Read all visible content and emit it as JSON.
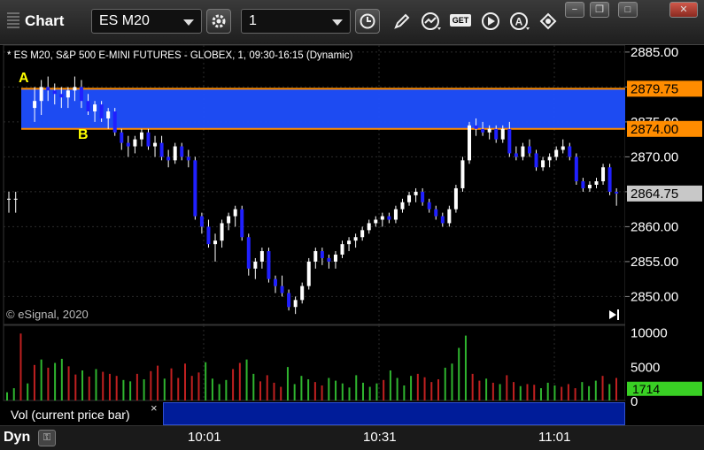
{
  "app": {
    "title": "Chart"
  },
  "toolbar": {
    "symbol": "ES M20",
    "interval": "1",
    "buttons": [
      "gear-icon",
      "clock-icon",
      "pencil-icon",
      "study-icon",
      "get-icon",
      "play-icon",
      "alert-icon",
      "link-icon"
    ],
    "get_label": "GET",
    "alert_label": "A"
  },
  "window_buttons": {
    "min": "−",
    "restore": "❐",
    "max": "□",
    "close": "✕"
  },
  "chart_data": {
    "type": "candlestick",
    "title": "* ES M20, S&P 500 E-MINI FUTURES - GLOBEX, 1, 09:30-16:15 (Dynamic)",
    "watermark": "© eSignal, 2020",
    "ylim": [
      2846,
      2886
    ],
    "yticks": [
      "2885.00",
      "2880.00",
      "2875.00",
      "2870.00",
      "2865.00",
      "2860.00",
      "2855.00",
      "2850.00"
    ],
    "band": {
      "top": 2879.75,
      "bottom": 2874.0,
      "color": "#1f4fff",
      "line_color": "#ff8c00"
    },
    "labels": {
      "band_top": "2879.75",
      "band_bottom": "2874.00",
      "last_price": "2864.75",
      "point_a": "A",
      "point_b": "B"
    },
    "last_price_value": 2864.75,
    "up_color": "#ffffff",
    "down_color": "#2020ff",
    "xticks": [
      "10:01",
      "10:31",
      "11:01"
    ],
    "candles_ohlc": [
      [
        2864,
        2865,
        2862,
        2864
      ],
      [
        2864,
        2865,
        2862,
        2864
      ],
      [
        2877,
        2880,
        2875,
        2878
      ],
      [
        2878,
        2881,
        2876,
        2880
      ],
      [
        2880,
        2881.5,
        2878,
        2879.5
      ],
      [
        2879.5,
        2880.5,
        2877.5,
        2879
      ],
      [
        2879,
        2880,
        2877,
        2878.5
      ],
      [
        2878.5,
        2880,
        2877,
        2879.5
      ],
      [
        2879.5,
        2881.5,
        2878,
        2880
      ],
      [
        2880,
        2881,
        2877,
        2878
      ],
      [
        2878,
        2879,
        2876,
        2876.5
      ],
      [
        2876.5,
        2878,
        2875,
        2877.5
      ],
      [
        2877.5,
        2878,
        2875,
        2875.5
      ],
      [
        2875.5,
        2877,
        2874,
        2876.5
      ],
      [
        2876.5,
        2877,
        2873,
        2873.5
      ],
      [
        2873.5,
        2874,
        2871,
        2872
      ],
      [
        2872,
        2873,
        2870,
        2871.5
      ],
      [
        2871.5,
        2873,
        2870.5,
        2872.5
      ],
      [
        2872.5,
        2874,
        2871.5,
        2873.5
      ],
      [
        2873.5,
        2874,
        2871,
        2871.5
      ],
      [
        2871.5,
        2873,
        2870,
        2872
      ],
      [
        2872,
        2873,
        2869.5,
        2870
      ],
      [
        2870,
        2871,
        2868.5,
        2869.5
      ],
      [
        2869.5,
        2872,
        2869,
        2871.5
      ],
      [
        2871.5,
        2872,
        2869.5,
        2870
      ],
      [
        2870,
        2871,
        2868.5,
        2869.5
      ],
      [
        2869.5,
        2870,
        2861,
        2861.5
      ],
      [
        2861.5,
        2862,
        2859,
        2860
      ],
      [
        2860,
        2861,
        2857,
        2857.5
      ],
      [
        2857.5,
        2859,
        2855,
        2858
      ],
      [
        2858,
        2861,
        2857,
        2860.5
      ],
      [
        2860.5,
        2862,
        2859.5,
        2861.5
      ],
      [
        2861.5,
        2863,
        2860,
        2862.5
      ],
      [
        2862.5,
        2863,
        2858,
        2858.5
      ],
      [
        2858.5,
        2859,
        2853,
        2854
      ],
      [
        2854,
        2855.5,
        2852.5,
        2855
      ],
      [
        2855,
        2857,
        2854,
        2856.5
      ],
      [
        2856.5,
        2857,
        2852,
        2852.5
      ],
      [
        2852.5,
        2853,
        2850.5,
        2851.5
      ],
      [
        2851.5,
        2853,
        2850,
        2850.5
      ],
      [
        2850.5,
        2851,
        2848,
        2848.5
      ],
      [
        2848.5,
        2850,
        2847.5,
        2849.5
      ],
      [
        2849.5,
        2852,
        2849,
        2851.5
      ],
      [
        2851.5,
        2855.5,
        2851,
        2855
      ],
      [
        2855,
        2857,
        2854,
        2856.5
      ],
      [
        2856.5,
        2857,
        2854.5,
        2855.5
      ],
      [
        2855.5,
        2856,
        2854,
        2855
      ],
      [
        2855,
        2856.5,
        2854,
        2856
      ],
      [
        2856,
        2858,
        2855.5,
        2857.5
      ],
      [
        2857.5,
        2858.5,
        2856.5,
        2858
      ],
      [
        2858,
        2859,
        2857,
        2858.5
      ],
      [
        2858.5,
        2860,
        2858,
        2859.5
      ],
      [
        2859.5,
        2861,
        2859,
        2860.5
      ],
      [
        2860.5,
        2861.5,
        2860,
        2861
      ],
      [
        2861,
        2862,
        2860,
        2861.5
      ],
      [
        2861.5,
        2862,
        2860.5,
        2861
      ],
      [
        2861,
        2863,
        2860.5,
        2862.5
      ],
      [
        2862.5,
        2864,
        2862,
        2863.5
      ],
      [
        2863.5,
        2865,
        2863,
        2864.5
      ],
      [
        2864.5,
        2865.5,
        2863.5,
        2865
      ],
      [
        2865,
        2865.5,
        2863,
        2863.5
      ],
      [
        2863.5,
        2864,
        2862,
        2862.5
      ],
      [
        2862.5,
        2863,
        2861,
        2861.5
      ],
      [
        2861.5,
        2862,
        2860,
        2860.5
      ],
      [
        2860.5,
        2863,
        2860,
        2862.5
      ],
      [
        2862.5,
        2866,
        2862,
        2865.5
      ],
      [
        2865.5,
        2870,
        2865,
        2869.5
      ],
      [
        2869.5,
        2875,
        2869,
        2874.5
      ],
      [
        2874.5,
        2875.5,
        2873,
        2874
      ],
      [
        2874,
        2875,
        2873,
        2873.5
      ],
      [
        2873.5,
        2874.5,
        2872.5,
        2874
      ],
      [
        2874,
        2874.5,
        2872,
        2872.5
      ],
      [
        2872.5,
        2874.5,
        2872,
        2874
      ],
      [
        2874,
        2875,
        2870,
        2870.5
      ],
      [
        2870.5,
        2871.5,
        2869.5,
        2870
      ],
      [
        2870,
        2872,
        2869.5,
        2871.5
      ],
      [
        2871.5,
        2872.5,
        2870,
        2870.5
      ],
      [
        2870.5,
        2871,
        2868,
        2868.5
      ],
      [
        2868.5,
        2870,
        2868,
        2869.5
      ],
      [
        2869.5,
        2870.5,
        2868.5,
        2870
      ],
      [
        2870,
        2871.5,
        2869.5,
        2871
      ],
      [
        2871,
        2872.5,
        2870.5,
        2871.5
      ],
      [
        2871.5,
        2872,
        2869.5,
        2870
      ],
      [
        2870,
        2870.5,
        2866,
        2866.5
      ],
      [
        2866.5,
        2867,
        2865,
        2865.5
      ],
      [
        2865.5,
        2866.5,
        2865,
        2866
      ],
      [
        2866,
        2867,
        2865.5,
        2866.5
      ],
      [
        2866.5,
        2869,
        2866,
        2868.5
      ],
      [
        2868.5,
        2869,
        2864.5,
        2865
      ],
      [
        2865,
        2865.5,
        2863,
        2864.75
      ]
    ],
    "volume": {
      "ylim": [
        0,
        11000
      ],
      "yticks": [
        "10000",
        "5000",
        "0"
      ],
      "last_value_label": "1714",
      "last_value": 1714,
      "bars": [
        1200,
        1800,
        9800,
        2500,
        5200,
        6000,
        4800,
        5500,
        6100,
        5000,
        3800,
        4400,
        3500,
        4600,
        4200,
        3900,
        3600,
        3000,
        2800,
        3900,
        3100,
        4300,
        5100,
        3200,
        4700,
        3300,
        5400,
        3600,
        4100,
        5600,
        3200,
        2400,
        3000,
        4600,
        5500,
        6000,
        3900,
        2800,
        3700,
        2600,
        2000,
        4900,
        2400,
        3600,
        3100,
        2700,
        2200,
        3300,
        2900,
        2500,
        1900,
        3700,
        2600,
        2000,
        2500,
        3000,
        4400,
        3300,
        2200,
        3600,
        3900,
        3400,
        2700,
        3100,
        4800,
        5400,
        7700,
        9500,
        3900,
        2900,
        3200,
        2600,
        2400,
        3700,
        2700,
        2100,
        2400,
        2300,
        1800,
        2600,
        2200,
        2000,
        2400,
        1800,
        2700,
        2100,
        2900,
        3600,
        2400,
        3300
      ],
      "colors": [
        "g",
        "g",
        "r",
        "g",
        "r",
        "g",
        "r",
        "g",
        "g",
        "r",
        "r",
        "g",
        "r",
        "g",
        "r",
        "r",
        "r",
        "g",
        "g",
        "r",
        "g",
        "r",
        "r",
        "g",
        "r",
        "r",
        "r",
        "r",
        "r",
        "g",
        "g",
        "g",
        "g",
        "r",
        "r",
        "g",
        "g",
        "r",
        "r",
        "r",
        "r",
        "g",
        "g",
        "g",
        "g",
        "r",
        "r",
        "g",
        "g",
        "g",
        "g",
        "g",
        "g",
        "g",
        "g",
        "r",
        "g",
        "g",
        "g",
        "g",
        "r",
        "r",
        "r",
        "r",
        "g",
        "g",
        "g",
        "g",
        "r",
        "r",
        "g",
        "r",
        "g",
        "r",
        "r",
        "g",
        "r",
        "r",
        "g",
        "g",
        "g",
        "r",
        "r",
        "r",
        "g",
        "g",
        "g",
        "r",
        "g",
        "r"
      ]
    }
  },
  "volume_panel": {
    "label": "Vol (current price bar)",
    "close": "×"
  },
  "statusbar": {
    "mode": "Dyn"
  }
}
